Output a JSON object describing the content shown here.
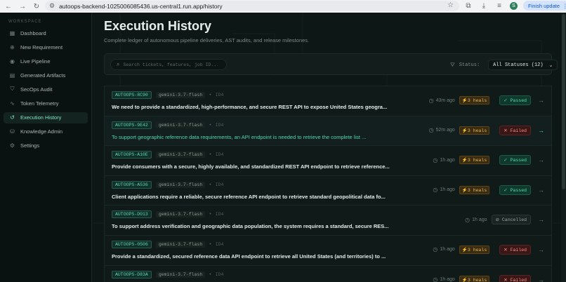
{
  "browser": {
    "url": "autoops-backend-1025006085436.us-central1.run.app/history",
    "avatar_letter": "S",
    "finish_update_label": "Finish update"
  },
  "sidebar": {
    "workspace_label": "WORKSPACE",
    "items": [
      {
        "label": "Dashboard",
        "icon": "grid-icon",
        "active": false
      },
      {
        "label": "New Requirement",
        "icon": "plus-circle-icon",
        "active": false
      },
      {
        "label": "Live Pipeline",
        "icon": "pipeline-icon",
        "active": false
      },
      {
        "label": "Generated Artifacts",
        "icon": "file-icon",
        "active": false
      },
      {
        "label": "SecOps Audit",
        "icon": "shield-icon",
        "active": false
      },
      {
        "label": "Token Telemetry",
        "icon": "activity-icon",
        "active": false
      },
      {
        "label": "Execution History",
        "icon": "history-icon",
        "active": true
      },
      {
        "label": "Knowledge Admin",
        "icon": "database-icon",
        "active": false
      },
      {
        "label": "Settings",
        "icon": "gear-icon",
        "active": false
      }
    ]
  },
  "main": {
    "title": "Execution History",
    "subtitle": "Complete ledger of autonomous pipeline deliveries, AST audits, and release milestones.",
    "search_placeholder": "Search tickets, features, job ID...",
    "status_label": "Status:",
    "status_value": "All Statuses (12)",
    "rows": [
      {
        "ticket": "AUTOOPS-8C90",
        "model": "gemini-3.7-flash",
        "version": "ID4",
        "desc": "We need to provide a standardized, high-performance, and secure REST API to expose United States geogra...",
        "time": "43m ago",
        "heals": "⚡3 heals",
        "status": "Passed",
        "status_kind": "passed",
        "highlight": false
      },
      {
        "ticket": "AUTOOPS-9E42",
        "model": "gemini-3.7-flash",
        "version": "ID4",
        "desc": "To support geographic reference data requirements, an API endpoint is needed to retrieve the complete list ...",
        "time": "52m ago",
        "heals": "⚡3 heals",
        "status": "Failed",
        "status_kind": "failed",
        "highlight": true
      },
      {
        "ticket": "AUTOOPS-A10E",
        "model": "gemini-3.7-flash",
        "version": "ID4",
        "desc": "Provide consumers with a secure, highly available, and standardized REST API endpoint to retrieve reference...",
        "time": "1h ago",
        "heals": "⚡3 heals",
        "status": "Passed",
        "status_kind": "passed",
        "highlight": false
      },
      {
        "ticket": "AUTOOPS-A536",
        "model": "gemini-3.7-flash",
        "version": "ID4",
        "desc": "Client applications require a reliable, secure reference API endpoint to retrieve standard geopolitical data fo...",
        "time": "1h ago",
        "heals": "⚡3 heals",
        "status": "Passed",
        "status_kind": "passed",
        "highlight": false
      },
      {
        "ticket": "AUTOOPS-D013",
        "model": "gemini-3.7-flash",
        "version": "ID4",
        "desc": "To support address verification and geographic data population, the system requires a standard, secure RES...",
        "time": "1h ago",
        "heals": "",
        "status": "Cancelled",
        "status_kind": "cancelled",
        "highlight": false
      },
      {
        "ticket": "AUTOOPS-0506",
        "model": "gemini-3.7-flash",
        "version": "ID4",
        "desc": "Provide a standardized, secured reference data API endpoint to retrieve all United States (and territories) to ...",
        "time": "1h ago",
        "heals": "⚡3 heals",
        "status": "Failed",
        "status_kind": "failed",
        "highlight": false
      },
      {
        "ticket": "AUTOOPS-D83A",
        "model": "gemini-3.7-flash",
        "version": "ID4",
        "desc": "",
        "time": "1h ago",
        "heals": "⚡3 heals",
        "status": "Failed",
        "status_kind": "failed",
        "highlight": false
      }
    ]
  },
  "colors": {
    "accent": "#4fd6b0",
    "passed": "#4be0a7",
    "failed": "#ff8b80",
    "heals": "#e9b74d"
  }
}
